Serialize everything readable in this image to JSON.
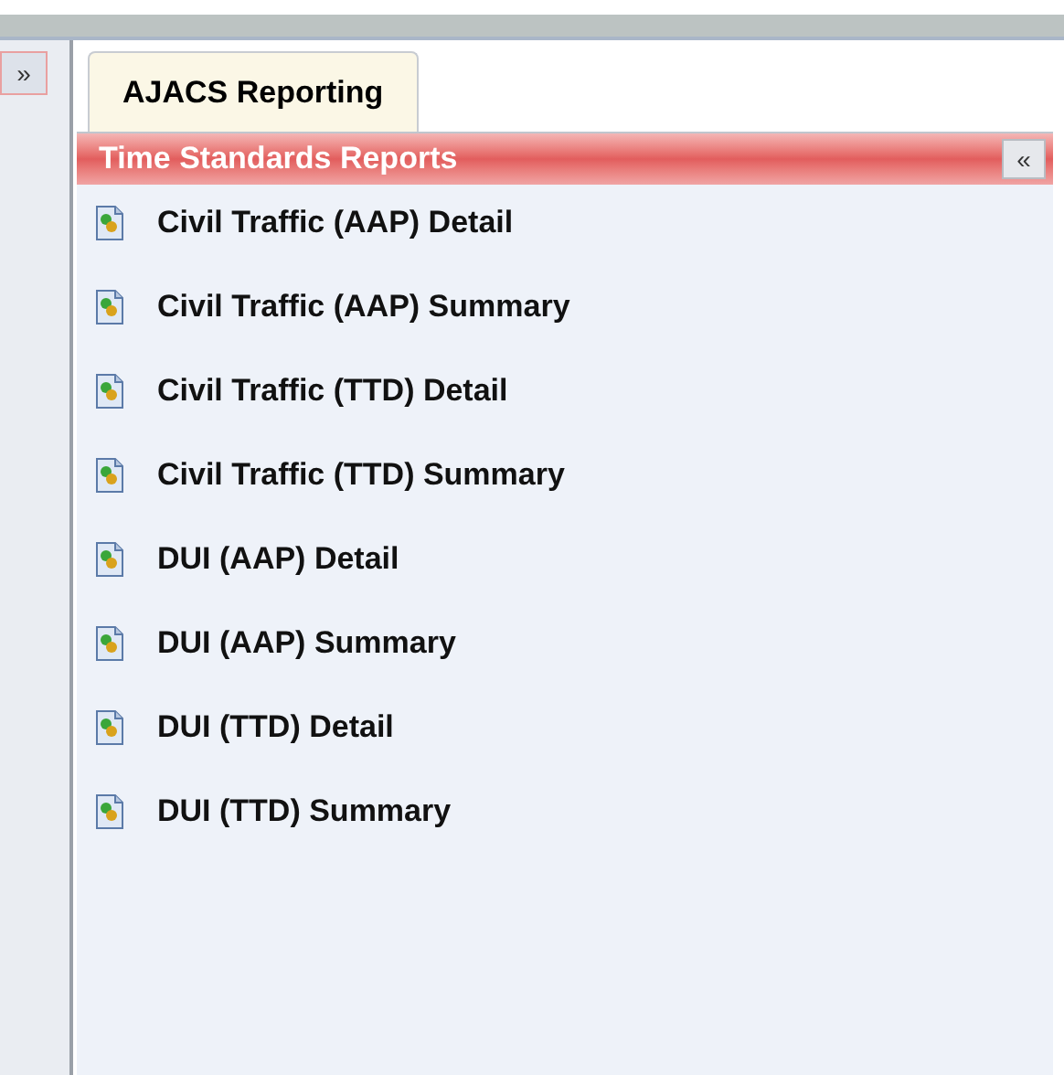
{
  "sidebar": {
    "expand_button": "»"
  },
  "tabs": [
    {
      "label": "AJACS Reporting",
      "selected": true
    }
  ],
  "panel": {
    "title": "Time Standards Reports",
    "collapse_button": "«",
    "items": [
      {
        "label": "Civil Traffic (AAP) Detail"
      },
      {
        "label": "Civil Traffic (AAP) Summary"
      },
      {
        "label": "Civil Traffic (TTD) Detail"
      },
      {
        "label": "Civil Traffic (TTD) Summary"
      },
      {
        "label": "DUI (AAP) Detail"
      },
      {
        "label": "DUI (AAP) Summary"
      },
      {
        "label": "DUI (TTD) Detail"
      },
      {
        "label": "DUI (TTD) Summary"
      }
    ]
  }
}
